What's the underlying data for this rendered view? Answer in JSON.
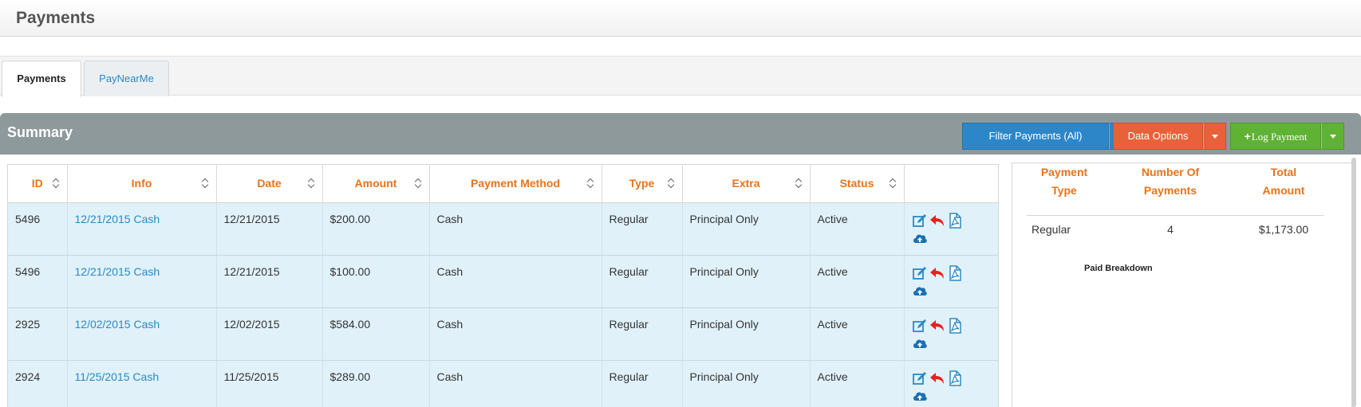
{
  "page": {
    "title": "Payments"
  },
  "tabs": [
    {
      "label": "Payments",
      "active": true
    },
    {
      "label": "PayNearMe",
      "active": false
    }
  ],
  "summary": {
    "title": "Summary"
  },
  "toolbar": {
    "filter_label": "Filter Payments (All)",
    "data_options_label": "Data Options",
    "log_payment_plus": "+",
    "log_payment_label": "Log Payment"
  },
  "table": {
    "columns": [
      "ID",
      "Info",
      "Date",
      "Amount",
      "Payment Method",
      "Type",
      "Extra",
      "Status",
      ""
    ],
    "rows": [
      {
        "id": "5496",
        "info": "12/21/2015 Cash",
        "date": "12/21/2015",
        "amount": "$200.00",
        "method": "Cash",
        "type": "Regular",
        "extra": "Principal Only",
        "status": "Active"
      },
      {
        "id": "5496",
        "info": "12/21/2015 Cash",
        "date": "12/21/2015",
        "amount": "$100.00",
        "method": "Cash",
        "type": "Regular",
        "extra": "Principal Only",
        "status": "Active"
      },
      {
        "id": "2925",
        "info": "12/02/2015 Cash",
        "date": "12/02/2015",
        "amount": "$584.00",
        "method": "Cash",
        "type": "Regular",
        "extra": "Principal Only",
        "status": "Active"
      },
      {
        "id": "2924",
        "info": "11/25/2015 Cash",
        "date": "11/25/2015",
        "amount": "$289.00",
        "method": "Cash",
        "type": "Regular",
        "extra": "Principal Only",
        "status": "Active"
      }
    ],
    "row_icons": [
      "edit-icon",
      "undo-icon",
      "pdf-icon",
      "cloud-upload-icon"
    ]
  },
  "side_summary": {
    "headers": [
      [
        "Payment",
        "Type"
      ],
      [
        "Number Of",
        "Payments"
      ],
      [
        "Total",
        "Amount"
      ]
    ],
    "rows": [
      {
        "type": "Regular",
        "count": "4",
        "total": "$1,173.00"
      }
    ],
    "breakdown_label": "Paid Breakdown"
  },
  "colors": {
    "accent_orange": "#e8731b",
    "link_blue": "#2a8ac4",
    "row_bg": "#e0f1fa",
    "summary_bar": "#8e999c",
    "btn_blue": "#2d86c8",
    "btn_orange": "#e8613a",
    "btn_green": "#5fb233"
  }
}
